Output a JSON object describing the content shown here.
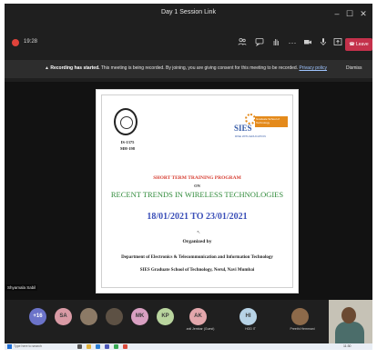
{
  "window": {
    "title": "Day 1 Session Link",
    "minimize": "–",
    "maximize": "☐",
    "close": "✕"
  },
  "toolbar": {
    "timer": "19:28",
    "leave_label": "Leave",
    "icons": [
      "participants-icon",
      "chat-icon",
      "raise-hand-icon",
      "more-icon",
      "camera-icon",
      "mic-icon",
      "share-icon"
    ]
  },
  "banner": {
    "bold": "Recording has started.",
    "text": " This meeting is being recorded. By joining, you are giving consent for this meeting to be recorded.",
    "link": "Privacy policy",
    "dismiss": "Dismiss"
  },
  "slide": {
    "iso_line1": "IS-1375",
    "iso_line2": "MH-198",
    "sies_word": "SIES",
    "sies_box": "Graduate School of Technology",
    "sies_motto": "RISE WITH EDUCATION",
    "program": "SHORT TERM TRAINING PROGRAM",
    "on": "ON",
    "title": "RECENT TRENDS IN WIRELESS TECHNOLOGIES",
    "dates": "18/01/2021 TO 23/01/2021",
    "organized": "Organized by",
    "department": "Department of Electronics & Telecommunication and Information Technology",
    "institute": "SIES Graduate School of Technology, Nerul, Navi Mumbai"
  },
  "presenter_label": "Shyamala Sabil",
  "participants": [
    {
      "initials": "+16",
      "color": "#6b73c9",
      "name": ""
    },
    {
      "initials": "SA",
      "color": "#d99aa5",
      "name": ""
    },
    {
      "initials": "",
      "color": "#8c7a66",
      "name": ""
    },
    {
      "initials": "",
      "color": "#5d5144",
      "name": ""
    },
    {
      "initials": "MK",
      "color": "#d9a0c2",
      "name": ""
    },
    {
      "initials": "KP",
      "color": "#b9d59e",
      "name": ""
    },
    {
      "initials": "AK",
      "color": "#e3a7ac",
      "name": "anil Jembar (Guest)"
    },
    {
      "initials": "HI",
      "color": "#b7d3e6",
      "name": "HOD IT"
    },
    {
      "initials": "",
      "color": "#8d6a4a",
      "name": "Preethi Hemmani"
    }
  ],
  "taskbar": {
    "search_placeholder": "Type here to search",
    "clock": "11:30"
  },
  "colors": {
    "leave": "#c4314b",
    "rec_dot": "#e0433b",
    "title_green": "#2f8a3a",
    "dates_blue": "#3b4fb8",
    "program_red": "#d63a2e"
  }
}
